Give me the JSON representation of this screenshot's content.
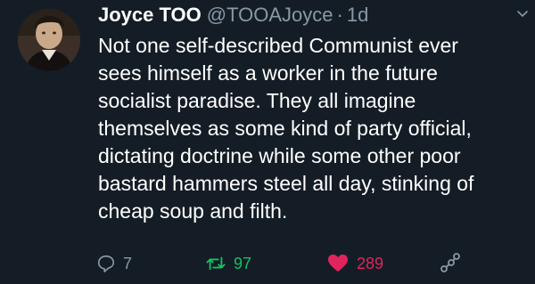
{
  "tweet": {
    "name": "Joyce TOO",
    "handle": "@TOOAJoyce",
    "separator": "·",
    "time": "1d",
    "lines": [
      "Not one self-described Communist ever",
      "sees himself as a worker in the future",
      "socialist paradise. They all imagine",
      "themselves as some kind of party official,",
      "dictating doctrine while some other poor",
      "bastard hammers steel all day, stinking of",
      "cheap soup and filth."
    ],
    "replies": "7",
    "retweets": "97",
    "likes": "289"
  },
  "colors": {
    "background": "#141d26",
    "muted": "#8899a6",
    "retweet_active": "#17bf63",
    "like_active": "#e0245e"
  },
  "icons": {
    "reply": "reply-icon",
    "retweet": "retweet-icon",
    "like": "heart-icon",
    "share": "share-icon",
    "menu": "chevron-down-icon"
  }
}
